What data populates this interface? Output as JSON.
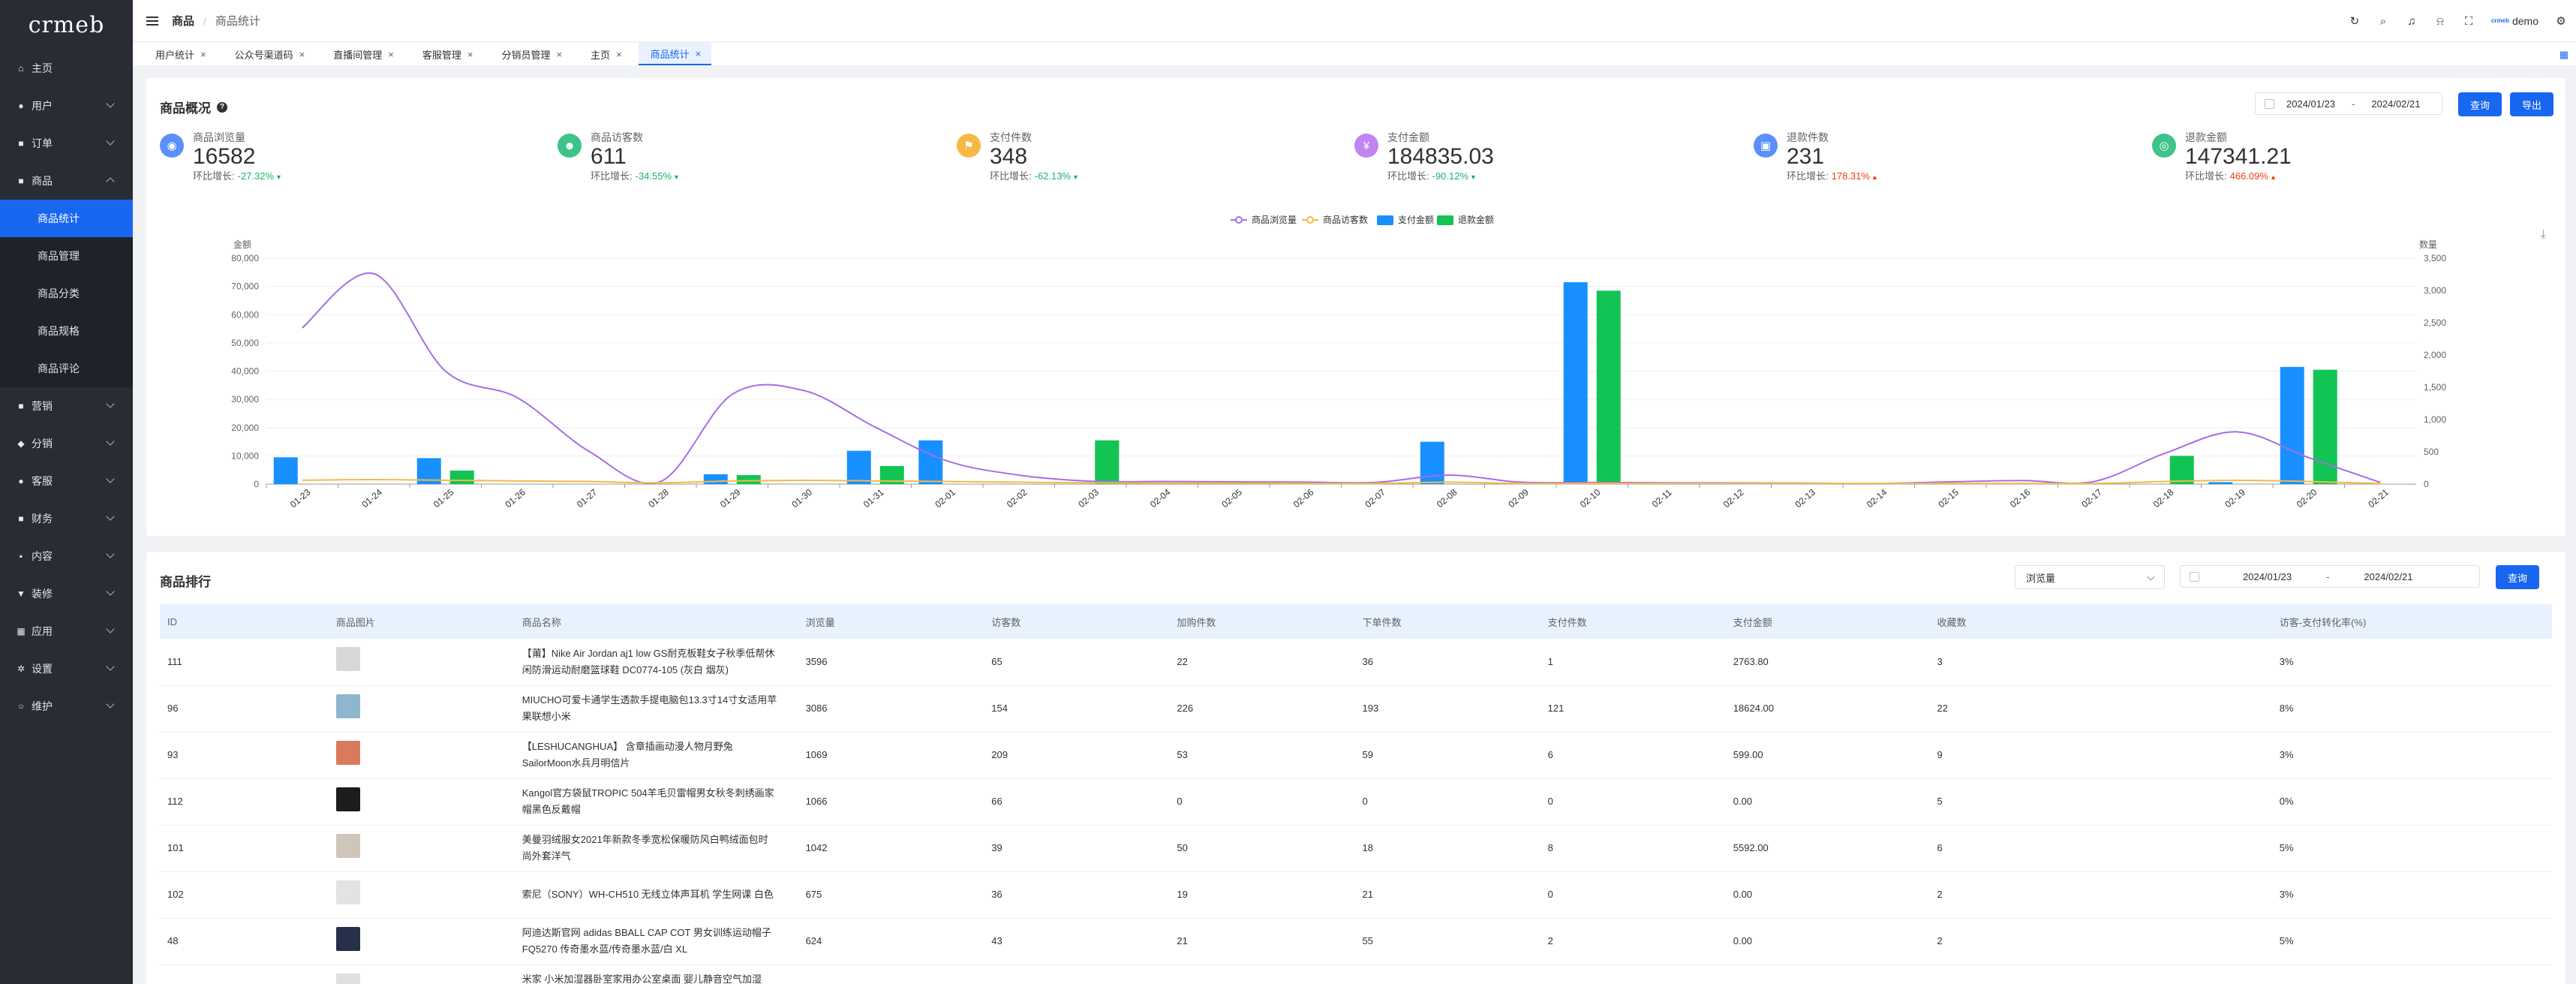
{
  "sidebar": {
    "logo": "crmeb",
    "items": [
      {
        "label": "主页",
        "icon": "home-icon",
        "glyph": "⌂",
        "has_children": false
      },
      {
        "label": "用户",
        "icon": "user-icon",
        "glyph": "●",
        "has_children": true
      },
      {
        "label": "订单",
        "icon": "order-icon",
        "glyph": "■",
        "has_children": true
      },
      {
        "label": "商品",
        "icon": "product-icon",
        "glyph": "■",
        "has_children": true,
        "expanded": true
      },
      {
        "label": "营销",
        "icon": "marketing-icon",
        "glyph": "■",
        "has_children": true
      },
      {
        "label": "分销",
        "icon": "distribution-icon",
        "glyph": "◆",
        "has_children": true
      },
      {
        "label": "客服",
        "icon": "service-icon",
        "glyph": "●",
        "has_children": true
      },
      {
        "label": "财务",
        "icon": "finance-icon",
        "glyph": "■",
        "has_children": true
      },
      {
        "label": "内容",
        "icon": "content-icon",
        "glyph": "▪",
        "has_children": true
      },
      {
        "label": "装修",
        "icon": "decoration-icon",
        "glyph": "▼",
        "has_children": true
      },
      {
        "label": "应用",
        "icon": "apps-icon",
        "glyph": "▦",
        "has_children": true
      },
      {
        "label": "设置",
        "icon": "settings-icon",
        "glyph": "✲",
        "has_children": true
      },
      {
        "label": "维护",
        "icon": "maintenance-icon",
        "glyph": "○",
        "has_children": true
      }
    ],
    "submenu": [
      "商品统计",
      "商品管理",
      "商品分类",
      "商品规格",
      "商品评论"
    ],
    "active_submenu": "商品统计"
  },
  "header": {
    "breadcrumb_1": "商品",
    "breadcrumb_sep": "/",
    "breadcrumb_2": "商品统计",
    "user_name": "demo",
    "avatar_text": "crmeb"
  },
  "tabs": [
    {
      "label": "用户统计",
      "active": false
    },
    {
      "label": "公众号渠道码",
      "active": false
    },
    {
      "label": "直播间管理",
      "active": false
    },
    {
      "label": "客服管理",
      "active": false
    },
    {
      "label": "分销员管理",
      "active": false
    },
    {
      "label": "主页",
      "active": false
    },
    {
      "label": "商品统计",
      "active": true
    }
  ],
  "overview": {
    "title": "商品概况",
    "date_start": "2024/01/23",
    "date_sep": "-",
    "date_end": "2024/02/21",
    "query_label": "查询",
    "export_label": "导出",
    "kpis": [
      {
        "label": "商品浏览量",
        "value": "16582",
        "growth_label": "环比增长:",
        "growth": "-27.32%",
        "trend": "down",
        "arrow": "▼",
        "color": "#5b8ff9",
        "icon": "eye-icon",
        "glyph": "◉"
      },
      {
        "label": "商品访客数",
        "value": "611",
        "growth_label": "环比增长:",
        "growth": "-34.55%",
        "trend": "down",
        "arrow": "▼",
        "color": "#3ec38a",
        "icon": "visitor-icon",
        "glyph": "☻"
      },
      {
        "label": "支付件数",
        "value": "348",
        "growth_label": "环比增长:",
        "growth": "-62.13%",
        "trend": "down",
        "arrow": "▼",
        "color": "#f7b946",
        "icon": "package-icon",
        "glyph": "⚑"
      },
      {
        "label": "支付金额",
        "value": "184835.03",
        "growth_label": "环比增长:",
        "growth": "-90.12%",
        "trend": "down",
        "arrow": "▼",
        "color": "#c085f1",
        "icon": "money-icon",
        "glyph": "¥"
      },
      {
        "label": "退款件数",
        "value": "231",
        "growth_label": "环比增长:",
        "growth": "178.31%",
        "trend": "up",
        "arrow": "▲",
        "color": "#5b8ff9",
        "icon": "refund-count-icon",
        "glyph": "▣"
      },
      {
        "label": "退款金额",
        "value": "147341.21",
        "growth_label": "环比增长:",
        "growth": "466.09%",
        "trend": "up",
        "arrow": "▲",
        "color": "#3ec38a",
        "icon": "refund-amount-icon",
        "glyph": "◎"
      }
    ]
  },
  "chart_data": {
    "type": "bar",
    "categories": [
      "01-23",
      "01-24",
      "01-25",
      "01-26",
      "01-27",
      "01-28",
      "01-29",
      "01-30",
      "01-31",
      "02-01",
      "02-02",
      "02-03",
      "02-04",
      "02-05",
      "02-06",
      "02-07",
      "02-08",
      "02-09",
      "02-10",
      "02-11",
      "02-12",
      "02-13",
      "02-14",
      "02-15",
      "02-16",
      "02-17",
      "02-18",
      "02-19",
      "02-20",
      "02-21"
    ],
    "ylabel_left": "金额",
    "ylabel_right": "数量",
    "ylim_left": [
      0,
      80000
    ],
    "yticks_left": [
      "0",
      "10,000",
      "20,000",
      "30,000",
      "40,000",
      "50,000",
      "60,000",
      "70,000",
      "80,000"
    ],
    "ylim_right": [
      0,
      3500
    ],
    "yticks_right": [
      "0",
      "500",
      "1,000",
      "1,500",
      "2,000",
      "2,500",
      "3,000",
      "3,500"
    ],
    "legend_position": "top-center",
    "grid": true,
    "series": [
      {
        "name": "商品浏览量",
        "kind": "line",
        "axis": "right",
        "color": "#a56ee6",
        "values": [
          2420,
          3260,
          1750,
          1340,
          510,
          40,
          1390,
          1450,
          880,
          360,
          140,
          45,
          40,
          35,
          30,
          28,
          140,
          30,
          25,
          20,
          18,
          15,
          10,
          35,
          55,
          40,
          480,
          810,
          410,
          25
        ]
      },
      {
        "name": "商品访客数",
        "kind": "line",
        "axis": "right",
        "color": "#f7b946",
        "values": [
          60,
          70,
          60,
          50,
          40,
          20,
          50,
          60,
          50,
          40,
          30,
          20,
          15,
          15,
          10,
          10,
          30,
          10,
          10,
          10,
          10,
          10,
          10,
          10,
          10,
          10,
          40,
          60,
          40,
          10
        ]
      },
      {
        "name": "支付金额",
        "kind": "bar",
        "axis": "left",
        "color": "#1890ff",
        "values": [
          9500,
          0,
          9200,
          0,
          0,
          0,
          3500,
          0,
          11800,
          15500,
          0,
          0,
          0,
          0,
          0,
          0,
          15000,
          0,
          71500,
          0,
          0,
          0,
          0,
          0,
          0,
          0,
          0,
          700,
          41500,
          0
        ]
      },
      {
        "name": "退款金额",
        "kind": "bar",
        "axis": "left",
        "color": "#12c454",
        "values": [
          0,
          0,
          4800,
          0,
          0,
          0,
          3200,
          0,
          6400,
          0,
          0,
          15500,
          0,
          0,
          0,
          0,
          0,
          0,
          68500,
          0,
          0,
          0,
          0,
          0,
          0,
          0,
          10000,
          0,
          40500,
          0
        ]
      }
    ]
  },
  "ranking": {
    "title": "商品排行",
    "sort_select": "浏览量",
    "date_start": "2024/01/23",
    "date_sep": "-",
    "date_end": "2024/02/21",
    "query_label": "查询",
    "columns": [
      "ID",
      "商品图片",
      "商品名称",
      "浏览量",
      "访客数",
      "加购件数",
      "下单件数",
      "支付件数",
      "支付金额",
      "收藏数",
      "访客-支付转化率(%)"
    ],
    "rows": [
      {
        "id": "111",
        "thumb_color": "#d8d8d8",
        "name": "【莆】Nike Air Jordan aj1 low GS耐克板鞋女子秋季低帮休闲防滑运动耐磨篮球鞋 DC0774-105 (灰白 烟灰)",
        "views": "3596",
        "visitors": "65",
        "cart": "22",
        "orders": "36",
        "paid": "1",
        "amount": "2763.80",
        "favorites": "3",
        "conversion": "3%"
      },
      {
        "id": "96",
        "thumb_color": "#8fb6cf",
        "name": "MIUCHO可爱卡通学生透款手提电脑包13.3寸14寸女适用苹果联想小米",
        "views": "3086",
        "visitors": "154",
        "cart": "226",
        "orders": "193",
        "paid": "121",
        "amount": "18624.00",
        "favorites": "22",
        "conversion": "8%"
      },
      {
        "id": "93",
        "thumb_color": "#d97a5a",
        "name": "【LESHUCANGHUA】 含章插画动漫人物月野兔SailorMoon水兵月明信片",
        "views": "1069",
        "visitors": "209",
        "cart": "53",
        "orders": "59",
        "paid": "6",
        "amount": "599.00",
        "favorites": "9",
        "conversion": "3%"
      },
      {
        "id": "112",
        "thumb_color": "#1c1c1c",
        "name": "Kangol官方袋鼠TROPIC 504羊毛贝雷帽男女秋冬刺绣画家帽黑色反戴帽",
        "views": "1066",
        "visitors": "66",
        "cart": "0",
        "orders": "0",
        "paid": "0",
        "amount": "0.00",
        "favorites": "5",
        "conversion": "0%"
      },
      {
        "id": "101",
        "thumb_color": "#cfc5b8",
        "name": "美曼羽绒服女2021年新款冬季宽松保暖防风白鸭绒面包时尚外套洋气",
        "views": "1042",
        "visitors": "39",
        "cart": "50",
        "orders": "18",
        "paid": "8",
        "amount": "5592.00",
        "favorites": "6",
        "conversion": "5%"
      },
      {
        "id": "102",
        "thumb_color": "#e3e3e3",
        "name": "索尼（SONY）WH-CH510 无线立体声耳机 学生网课 白色",
        "views": "675",
        "visitors": "36",
        "cart": "19",
        "orders": "21",
        "paid": "0",
        "amount": "0.00",
        "favorites": "2",
        "conversion": "3%"
      },
      {
        "id": "48",
        "thumb_color": "#263048",
        "name": "阿迪达斯官网 adidas BBALL CAP COT 男女训练运动帽子FQ5270 传奇墨水蓝/传奇墨水蓝/白 XL",
        "views": "624",
        "visitors": "43",
        "cart": "21",
        "orders": "55",
        "paid": "2",
        "amount": "0.00",
        "favorites": "2",
        "conversion": "5%"
      },
      {
        "id": "",
        "thumb_color": "#e0e0e0",
        "name": "米家 小米加湿器卧室家用办公室桌面 婴儿静音空气加湿 UV-C杀菌",
        "views": "",
        "visitors": "",
        "cart": "",
        "orders": "",
        "paid": "",
        "amount": "",
        "favorites": "",
        "conversion": ""
      }
    ]
  }
}
